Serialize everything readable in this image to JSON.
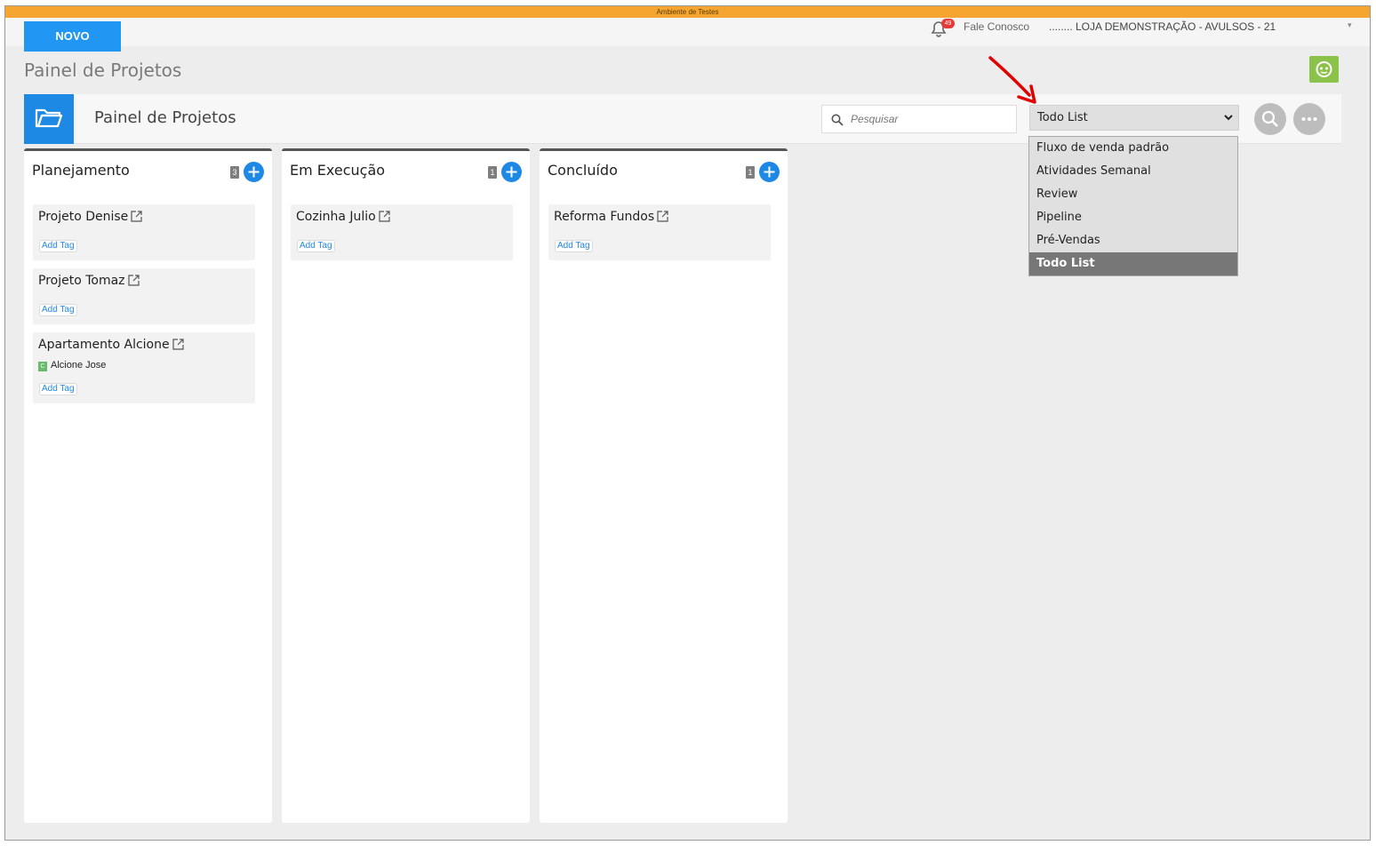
{
  "env_banner": "Ambiente de Testes",
  "topbar": {
    "new_button": "NOVO",
    "notifications_count": "49",
    "contact_link": "Fale Conosco",
    "store_name": "........ LOJA DEMONSTRAÇÃO - AVULSOS - 21"
  },
  "page_title": "Painel de Projetos",
  "header": {
    "title": "Painel de Projetos",
    "search_placeholder": "Pesquisar",
    "selected_board": "Todo List"
  },
  "board_dropdown": {
    "options": [
      "Fluxo de venda padrão",
      "Atividades Semanal",
      "Review",
      "Pipeline",
      "Pré-Vendas",
      "Todo List"
    ],
    "selected_index": 5
  },
  "columns": [
    {
      "title": "Planejamento",
      "count": "3",
      "cards": [
        {
          "title": "Projeto Denise",
          "add_tag": "Add Tag"
        },
        {
          "title": "Projeto Tomaz",
          "add_tag": "Add Tag"
        },
        {
          "title": "Apartamento Alcione",
          "contact_initial": "C",
          "contact_name": "Alcione Jose",
          "add_tag": "Add Tag"
        }
      ]
    },
    {
      "title": "Em Execução",
      "count": "1",
      "cards": [
        {
          "title": "Cozinha Julio",
          "add_tag": "Add Tag"
        }
      ]
    },
    {
      "title": "Concluído",
      "count": "1",
      "cards": [
        {
          "title": "Reforma Fundos",
          "add_tag": "Add Tag"
        }
      ]
    }
  ],
  "colors": {
    "env_bar": "#f6a531",
    "primary": "#1e88e5",
    "chat": "#8bc34a",
    "badge": "#e53935",
    "annotation_arrow": "#e00000"
  }
}
